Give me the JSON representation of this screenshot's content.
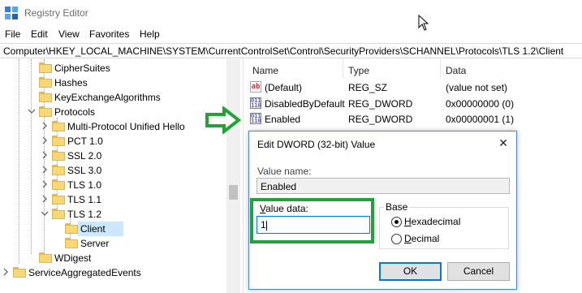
{
  "window": {
    "title": "Registry Editor"
  },
  "menu": [
    "File",
    "Edit",
    "View",
    "Favorites",
    "Help"
  ],
  "address": "Computer\\HKEY_LOCAL_MACHINE\\SYSTEM\\CurrentControlSet\\Control\\SecurityProviders\\SCHANNEL\\Protocols\\TLS 1.2\\Client",
  "tree": {
    "items": [
      {
        "label": "CipherSuites",
        "level": 1,
        "expander": "none"
      },
      {
        "label": "Hashes",
        "level": 1,
        "expander": "none"
      },
      {
        "label": "KeyExchangeAlgorithms",
        "level": 1,
        "expander": "none"
      },
      {
        "label": "Protocols",
        "level": 1,
        "expander": "expanded"
      },
      {
        "label": "Multi-Protocol Unified Hello",
        "level": 2,
        "expander": "collapsed"
      },
      {
        "label": "PCT 1.0",
        "level": 2,
        "expander": "collapsed"
      },
      {
        "label": "SSL 2.0",
        "level": 2,
        "expander": "collapsed"
      },
      {
        "label": "SSL 3.0",
        "level": 2,
        "expander": "collapsed"
      },
      {
        "label": "TLS 1.0",
        "level": 2,
        "expander": "collapsed"
      },
      {
        "label": "TLS 1.1",
        "level": 2,
        "expander": "collapsed"
      },
      {
        "label": "TLS 1.2",
        "level": 2,
        "expander": "expanded"
      },
      {
        "label": "Client",
        "level": 3,
        "expander": "none",
        "selected": true
      },
      {
        "label": "Server",
        "level": 3,
        "expander": "none"
      },
      {
        "label": "WDigest",
        "level": 1,
        "expander": "none"
      },
      {
        "label": "ServiceAggregatedEvents",
        "level": 0,
        "expander": "collapsed"
      }
    ]
  },
  "list": {
    "columns": [
      "Name",
      "Type",
      "Data"
    ],
    "rows": [
      {
        "icon": "string-value-icon",
        "name": "(Default)",
        "type": "REG_SZ",
        "data": "(value not set)"
      },
      {
        "icon": "dword-value-icon",
        "name": "DisabledByDefault",
        "type": "REG_DWORD",
        "data": "0x00000000 (0)"
      },
      {
        "icon": "dword-value-icon",
        "name": "Enabled",
        "type": "REG_DWORD",
        "data": "0x00000001 (1)"
      }
    ]
  },
  "dialog": {
    "title": "Edit DWORD (32-bit) Value",
    "close": "✕",
    "value_name_label": "Value name:",
    "value_name": "Enabled",
    "value_data_label": "Value data:",
    "value_data": "1",
    "base_label": "Base",
    "hex_label": "Hexadecimal",
    "dec_label": "Decimal",
    "base_selected": "Hexadecimal",
    "ok": "OK",
    "cancel": "Cancel"
  },
  "colors": {
    "highlight": "#22a33a",
    "accent": "#0078d7",
    "selection": "#cce8ff"
  }
}
